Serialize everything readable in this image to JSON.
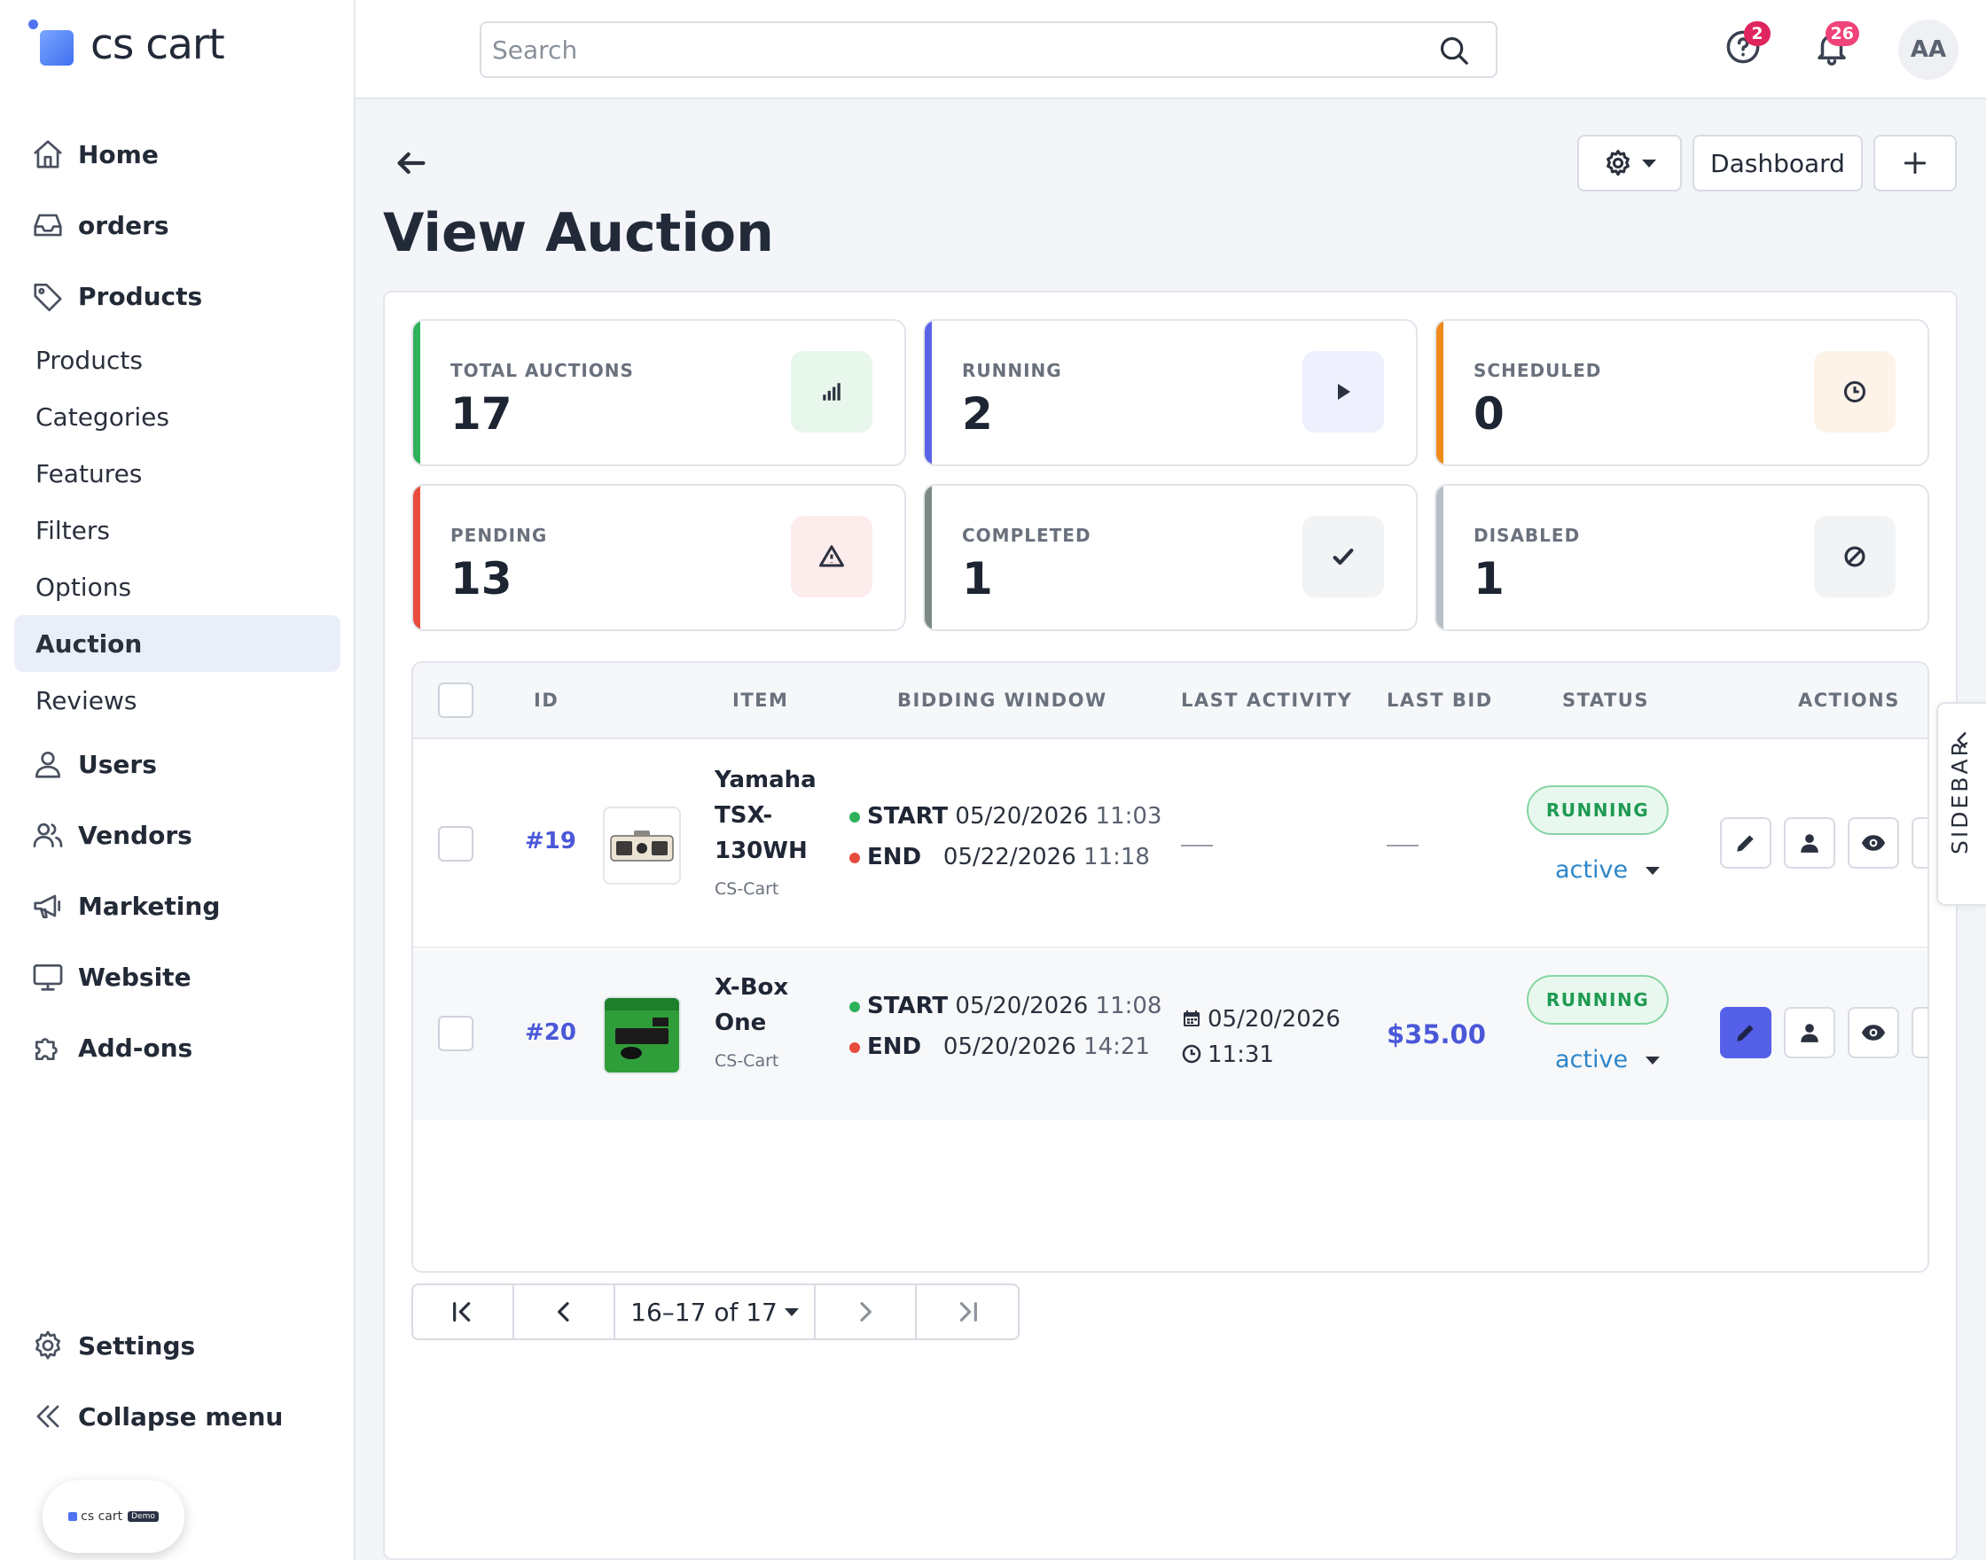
{
  "brand": {
    "name": "cs cart"
  },
  "sidebar": {
    "nav": [
      {
        "label": "Home",
        "icon": "home-icon"
      },
      {
        "label": "orders",
        "icon": "inbox-icon"
      },
      {
        "label": "Products",
        "icon": "tag-icon"
      }
    ],
    "products_sub": [
      "Products",
      "Categories",
      "Features",
      "Filters",
      "Options",
      "Auction",
      "Reviews"
    ],
    "active_sub": "Auction",
    "nav2": [
      {
        "label": "Users",
        "icon": "user-icon"
      },
      {
        "label": "Vendors",
        "icon": "users-icon"
      },
      {
        "label": "Marketing",
        "icon": "megaphone-icon"
      },
      {
        "label": "Website",
        "icon": "monitor-icon"
      },
      {
        "label": "Add-ons",
        "icon": "puzzle-icon"
      }
    ],
    "bottom": [
      {
        "label": "Settings",
        "icon": "gear-icon"
      },
      {
        "label": "Collapse menu",
        "icon": "double-chevron-left-icon"
      }
    ],
    "demo_badge": {
      "text": "cs cart",
      "tag": "Demo"
    }
  },
  "topbar": {
    "search_placeholder": "Search",
    "help_count": "2",
    "notification_count": "26",
    "avatar_initials": "AA"
  },
  "header": {
    "title": "View Auction",
    "dashboard_label": "Dashboard"
  },
  "stats": [
    {
      "label": "TOTAL AUCTIONS",
      "value": "17",
      "color": "#2fb05a",
      "icon": "bar-chart-icon",
      "icon_bg": "#e8f7ec"
    },
    {
      "label": "RUNNING",
      "value": "2",
      "color": "#5a63e6",
      "icon": "play-icon",
      "icon_bg": "#eef0fd"
    },
    {
      "label": "SCHEDULED",
      "value": "0",
      "color": "#ef8a1a",
      "icon": "clock-icon",
      "icon_bg": "#fdf3e8"
    },
    {
      "label": "PENDING",
      "value": "13",
      "color": "#e74c3c",
      "icon": "warning-icon",
      "icon_bg": "#fdecec"
    },
    {
      "label": "COMPLETED",
      "value": "1",
      "color": "#7c8a86",
      "icon": "check-icon",
      "icon_bg": "#f2f3f5"
    },
    {
      "label": "DISABLED",
      "value": "1",
      "color": "#b9bec6",
      "icon": "ban-icon",
      "icon_bg": "#f2f3f5"
    }
  ],
  "table": {
    "columns": [
      "ID",
      "ITEM",
      "BIDDING WINDOW",
      "LAST ACTIVITY",
      "LAST BID",
      "STATUS",
      "ACTIONS"
    ],
    "rows": [
      {
        "id": "#19",
        "item_lines": [
          "Yamaha",
          "TSX-",
          "130WH"
        ],
        "vendor": "CS-Cart",
        "start_label": "START",
        "start_date": "05/20/2026",
        "start_time": "11:03",
        "end_label": "END",
        "end_date": "05/22/2026",
        "end_time": "11:18",
        "last_activity": "—",
        "last_bid": "—",
        "status_badge": "RUNNING",
        "status_select": "active"
      },
      {
        "id": "#20",
        "item_lines": [
          "X-Box",
          "One"
        ],
        "vendor": "CS-Cart",
        "start_label": "START",
        "start_date": "05/20/2026",
        "start_time": "11:08",
        "end_label": "END",
        "end_date": "05/20/2026",
        "end_time": "14:21",
        "last_activity_date": "05/20/2026",
        "last_activity_time": "11:31",
        "last_bid": "$35.00",
        "status_badge": "RUNNING",
        "status_select": "active"
      }
    ]
  },
  "side_panel_label": "SIDEBAR",
  "pagination": {
    "range_label": "16–17 of 17"
  }
}
